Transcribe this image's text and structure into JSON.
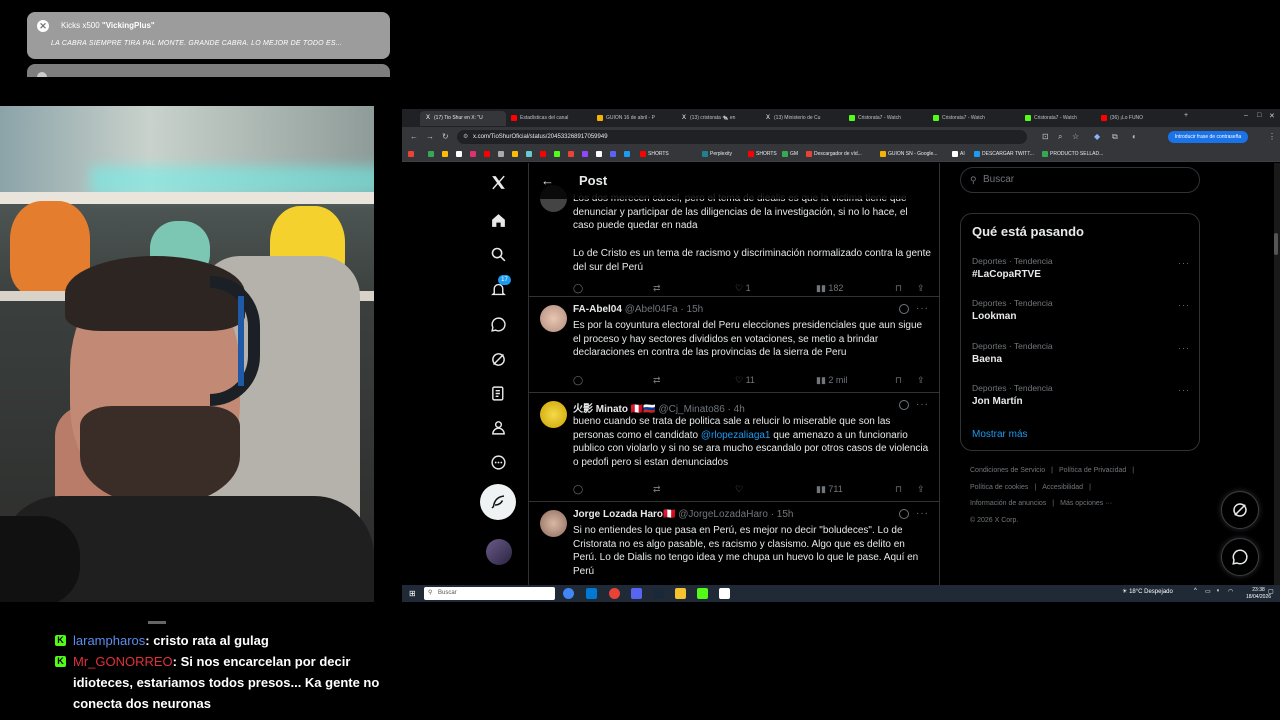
{
  "kick_alert": {
    "title_prefix": "Kicks x500",
    "title_user": "\"VickingPlus\"",
    "message": "LA CABRA SIEMPRE TIRA PAL MONTE. GRANDE CABRA. LO MEJOR DE TODO ES...",
    "close_glyph": "✕"
  },
  "chat": {
    "messages": [
      {
        "user": "larampharos",
        "user_color": "#5b8def",
        "text": ": cristo rata al gulag"
      },
      {
        "user": "Mr_GONORREO",
        "user_color": "#e0313b",
        "text": ": Si nos encarcelan por decir idioteces, estariamos todos presos... Ka gente no conecta dos neuronas"
      }
    ]
  },
  "browser": {
    "tabs": [
      {
        "label": "(17) Tio Shur en X: \"U",
        "icon_color": "#ffffff",
        "active": true
      },
      {
        "label": "Estadísticas del canal",
        "icon_color": "#ff0000"
      },
      {
        "label": "GUION 16 de abril - P",
        "icon_color": "#f4b400"
      },
      {
        "label": "(13) cristorata 🐀 en",
        "icon_color": "#ffffff"
      },
      {
        "label": "(13) Ministerio de Cu",
        "icon_color": "#ffffff"
      },
      {
        "label": "Cristorata7 - Watch",
        "icon_color": "#53fc18"
      },
      {
        "label": "Cristorata7 - Watch",
        "icon_color": "#53fc18"
      },
      {
        "label": "Cristorata7 - Watch",
        "icon_color": "#53fc18"
      },
      {
        "label": "(36) ¡Lo FUNO",
        "icon_color": "#ff0000"
      }
    ],
    "url": "x.com/TioShurOficial/status/2045332689170599​49",
    "password_pill": "Introducir frase de contraseña",
    "bookmarks": [
      "SHORTS",
      "Perplexity",
      "SHORTS",
      "GM",
      "Descargador de víd...",
      "GUION SN - Google...",
      "AI",
      "DESCARGAR TWITT...",
      "PRODUCTO SELLAD..."
    ]
  },
  "x": {
    "header_title": "Post",
    "notif_count": "17",
    "first_reply_text_1": "Los dos merecen cárcel, pero el tema de diealis es que la victima tiene que denunciar y participar de las diligencias de la investigación, si no lo hace, el caso puede quedar en nada",
    "first_reply_text_2": "Lo de Cristo es un tema de racismo y discriminación normalizado contra la gente del sur del Perú",
    "first_reply_likes": "1",
    "first_reply_views": "182",
    "replies": [
      {
        "name": "FA-Abel04",
        "handle": "@Abel04Fa · 15h",
        "text": "Es por la coyuntura electoral del Peru elecciones presidenciales que aun sigue el proceso y hay sectores divididos en votaciones, se metio a brindar declaraciones en contra de las provincias de la sierra de Peru",
        "likes": "11",
        "views": "2 mil"
      },
      {
        "name": "火影 Minato 🇵🇪🇷🇺",
        "handle": "@Cj_Minato86 · 4h",
        "text_before": "bueno cuando se trata de politica sale a relucir lo miserable que son las personas como el candidato ",
        "mention": "@rlopezaliaga1",
        "text_after": " que amenazo a un funcionario publico con violarlo  y si no se ara mucho escandalo por otros casos de violencia o pedofi pero si estan denunciados",
        "likes": "",
        "views": "711"
      },
      {
        "name": "Jorge Lozada Haro🇵🇪",
        "handle": "@JorgeLozadaHaro · 15h",
        "text": "Si no entiendes lo que pasa en Perú, es mejor no decir \"boludeces\". Lo de Cristorata no es algo pasable, es racismo y clasismo. Algo que es delito en Perú. Lo de Dialis no tengo idea y me chupa un huevo lo que le pase. Aquí en Perú"
      }
    ],
    "search_placeholder": "Buscar",
    "trends_title": "Qué está pasando",
    "trends": [
      {
        "meta": "Deportes · Tendencia",
        "name": "#LaCopaRTVE"
      },
      {
        "meta": "Deportes · Tendencia",
        "name": "Lookman"
      },
      {
        "meta": "Deportes · Tendencia",
        "name": "Baena"
      },
      {
        "meta": "Deportes · Tendencia",
        "name": "Jon Martín"
      }
    ],
    "show_more": "Mostrar más",
    "footer": [
      "Condiciones de Servicio",
      "|",
      "Política de Privacidad",
      "|",
      "Política de cookies",
      "|",
      "Accesibilidad",
      "|",
      "Información de anuncios",
      "|",
      "Más opciones ···",
      "© 2026 X Corp."
    ]
  },
  "taskbar": {
    "search_placeholder": "Buscar",
    "weather": "18°C  Despejado",
    "time": "23:38",
    "date": "18/04/2026"
  }
}
